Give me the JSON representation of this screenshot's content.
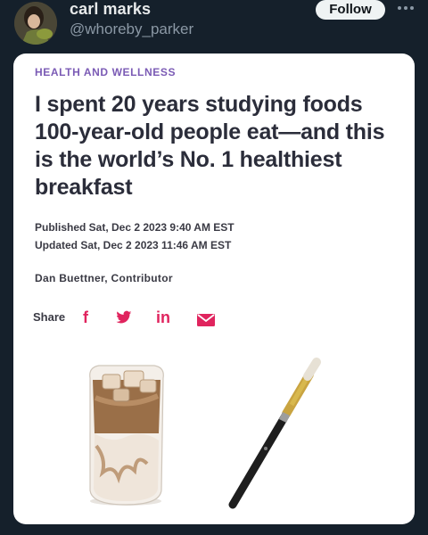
{
  "tweet": {
    "display_name": "carl marks",
    "handle": "@whoreby_parker",
    "follow_label": "Follow",
    "more_icon": "ellipsis-icon"
  },
  "article": {
    "category": "HEALTH AND WELLNESS",
    "headline": "I spent 20 years studying foods 100-year-old people eat—and this is the world’s No. 1 healthiest breakfast",
    "published": "Published Sat, Dec 2 2023 9:40 AM EST",
    "updated": "Updated Sat, Dec 2 2023 11:46 AM EST",
    "author": "Dan Buettner, Contributor",
    "share_label": "Share",
    "share_icons": [
      "facebook-icon",
      "twitter-icon",
      "linkedin-icon",
      "mail-icon"
    ],
    "accent_color": "#e0245e",
    "category_color": "#7b5bb5"
  }
}
